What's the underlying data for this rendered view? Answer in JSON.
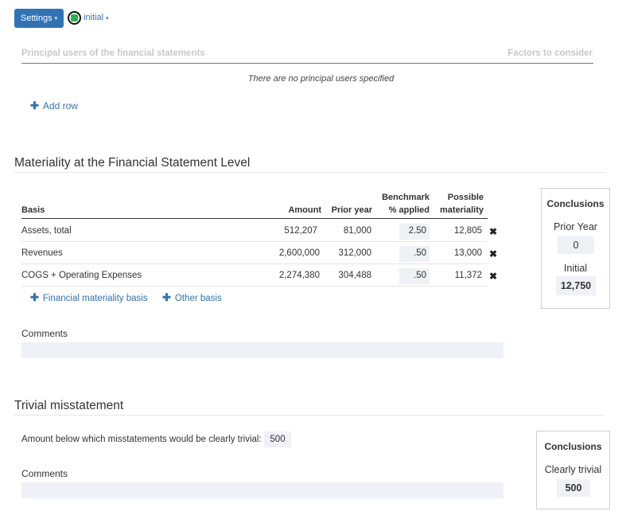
{
  "toolbar": {
    "settings_label": "Settings",
    "caret": "▾",
    "status_color": "#2bb24c",
    "stage_label": "initial"
  },
  "principal_users": {
    "header_left": "Principal users of the financial statements",
    "header_right": "Factors to consider",
    "empty_message": "There are no principal users specified",
    "add_row_label": "Add row"
  },
  "materiality": {
    "title": "Materiality at the Financial Statement Level",
    "columns": {
      "basis": "Basis",
      "amount": "Amount",
      "prior_year": "Prior year",
      "benchmark_line1": "Benchmark",
      "benchmark_line2": "% applied",
      "possible_line1": "Possible",
      "possible_line2": "materiality"
    },
    "rows": [
      {
        "basis": "Assets, total",
        "amount": "512,207",
        "prior_year": "81,000",
        "pct": "2.50",
        "possible": "12,805"
      },
      {
        "basis": "Revenues",
        "amount": "2,600,000",
        "prior_year": "312,000",
        "pct": ".50",
        "possible": "13,000"
      },
      {
        "basis": "COGS + Operating Expenses",
        "amount": "2,274,380",
        "prior_year": "304,488",
        "pct": ".50",
        "possible": "11,372"
      }
    ],
    "add_financial_basis": "Financial materiality basis",
    "add_other_basis": "Other basis",
    "comments_label": "Comments",
    "conclusions": {
      "title": "Conclusions",
      "prior_year_label": "Prior Year",
      "prior_year_value": "0",
      "initial_label": "Initial",
      "initial_value": "12,750"
    }
  },
  "trivial": {
    "title": "Trivial misstatement",
    "amount_label": "Amount below which misstatements would be clearly trivial:",
    "amount_value": "500",
    "comments_label": "Comments",
    "conclusions": {
      "title": "Conclusions",
      "clearly_trivial_label": "Clearly trivial",
      "clearly_trivial_value": "500"
    }
  },
  "icons": {
    "plus": "✚",
    "delete": "✖"
  },
  "colors": {
    "accent": "#2f73b6",
    "field_bg": "#eef1f6"
  }
}
